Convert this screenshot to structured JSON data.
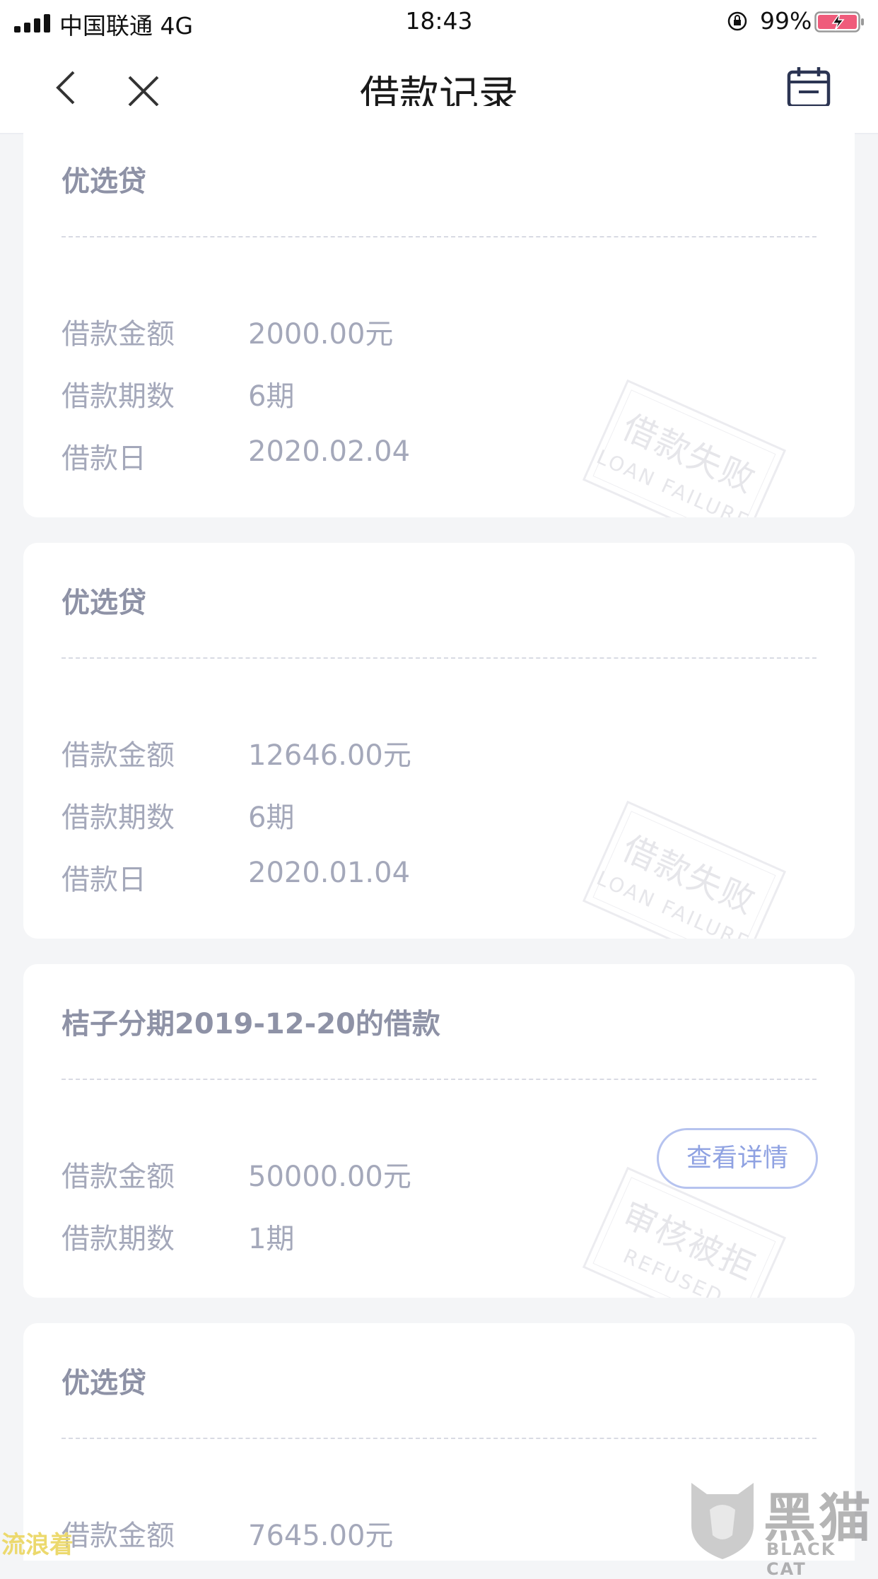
{
  "status_bar": {
    "carrier": "中国联通  4G",
    "time": "18:43",
    "battery": "99%"
  },
  "nav": {
    "title": "借款记录"
  },
  "labels": {
    "amount": "借款金额",
    "periods": "借款期数",
    "date": "借款日"
  },
  "cards": [
    {
      "title": "优选贷",
      "amount": "2000.00元",
      "periods": "6期",
      "date": "2020.02.04",
      "status_cn": "借款失败",
      "status_en": "LOAN FAILURE"
    },
    {
      "title": "优选贷",
      "amount": "12646.00元",
      "periods": "6期",
      "date": "2020.01.04",
      "status_cn": "借款失败",
      "status_en": "LOAN FAILURE"
    },
    {
      "title": "桔子分期2019-12-20的借款",
      "amount": "50000.00元",
      "periods": "1期",
      "status_cn": "审核被拒",
      "status_en": "REFUSED",
      "button": "查看详情"
    },
    {
      "title": "优选贷",
      "amount": "7645.00元"
    }
  ],
  "watermark": {
    "left_text": "流浪着",
    "brand_cn": "黑猫",
    "brand_en": "BLACK CAT"
  }
}
